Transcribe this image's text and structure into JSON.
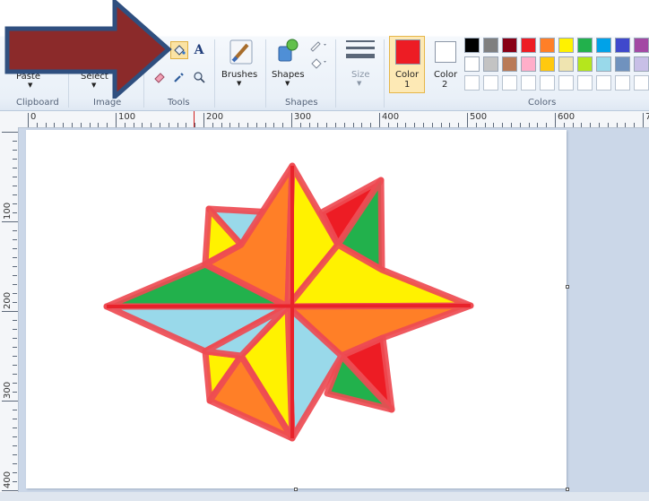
{
  "ribbon": {
    "clipboard": {
      "paste_label": "Paste",
      "group_label": "Clipboard"
    },
    "image": {
      "select_label": "Select",
      "group_label": "Image"
    },
    "tools": {
      "group_label": "Tools",
      "text_tool_glyph": "A"
    },
    "brushes": {
      "label": "Brushes"
    },
    "shapes": {
      "label": "Shapes",
      "group_label": "Shapes"
    },
    "size": {
      "label": "Size"
    },
    "color1": {
      "label": "Color",
      "number": "1",
      "value": "#ed1c24"
    },
    "color2": {
      "label": "Color",
      "number": "2",
      "value": "#ffffff"
    },
    "colors": {
      "group_label": "Colors",
      "row1": [
        "#000000",
        "#7f7f7f",
        "#880015",
        "#ed1c24",
        "#ff7f27",
        "#fff200",
        "#22b14c",
        "#00a2e8",
        "#3f48cc",
        "#a349a4"
      ],
      "row2": [
        "#ffffff",
        "#c3c3c3",
        "#b97a57",
        "#ffaec9",
        "#ffc90e",
        "#efe4b0",
        "#b5e61d",
        "#99d9ea",
        "#7092be",
        "#c8bfe7"
      ]
    }
  },
  "ruler": {
    "h_labels": [
      "0",
      "100",
      "200",
      "300",
      "400",
      "500",
      "600",
      "7"
    ],
    "v_labels": [
      "100",
      "200",
      "300",
      "400"
    ]
  },
  "drawing": {
    "description_colors": {
      "outline": "#ed1c24",
      "yellow": "#fff200",
      "orange": "#ff7f27",
      "green": "#22b14c",
      "light_blue": "#99d9ea"
    }
  },
  "annotation": {
    "arrow_color": "#8b2a2a",
    "arrow_border": "#2f4f7f"
  }
}
